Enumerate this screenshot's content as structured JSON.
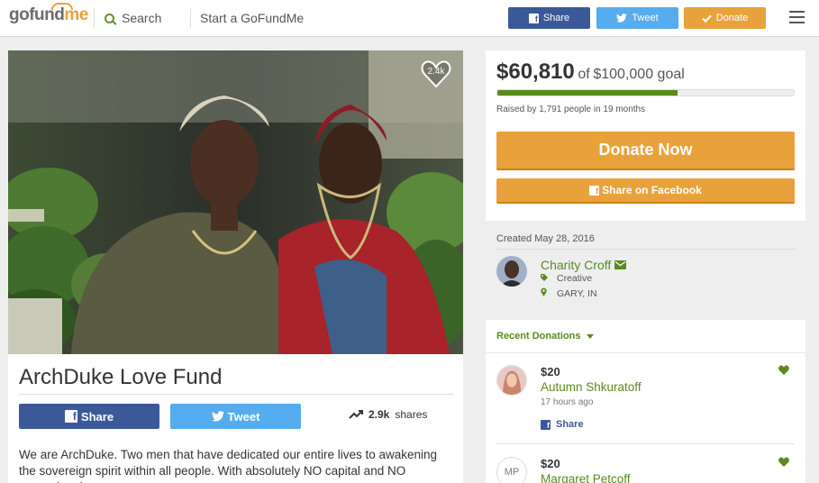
{
  "header": {
    "logo_go": "gofund",
    "logo_me": "me",
    "search_label": "Search",
    "start_label": "Start a GoFundMe",
    "share_label": "Share",
    "tweet_label": "Tweet",
    "donate_label": "Donate",
    "colors": {
      "facebook": "#3b5998",
      "twitter": "#55acee",
      "donate": "#e9a23b"
    }
  },
  "campaign": {
    "hearts": "2.4k",
    "title": "ArchDuke Love Fund",
    "share_label": "Share",
    "tweet_label": "Tweet",
    "shares_count": "2.9k",
    "shares_label": "shares",
    "description": "We are ArchDuke. Two men that have dedicated our entire lives to awakening the sovereign spirit within all people. With absolutely NO capital and NO promotional"
  },
  "funding": {
    "raised": "$60,810",
    "of_label": "of",
    "goal": "$100,000 goal",
    "progress_fraction": 0.6081,
    "byline": "Raised by 1,791 people in 19 months",
    "donate_now": "Donate Now",
    "share_facebook": "Share on Facebook"
  },
  "organizer": {
    "created": "Created May 28, 2016",
    "name": "Charity Croff",
    "category": "Creative",
    "location": "GARY, IN"
  },
  "donations": {
    "header": "Recent Donations",
    "items": [
      {
        "amount": "$20",
        "name": "Autumn Shkuratoff",
        "time": "17 hours ago",
        "share": "Share"
      },
      {
        "amount": "$20",
        "name": "Margaret Petcoff",
        "initials": "MP"
      }
    ]
  }
}
